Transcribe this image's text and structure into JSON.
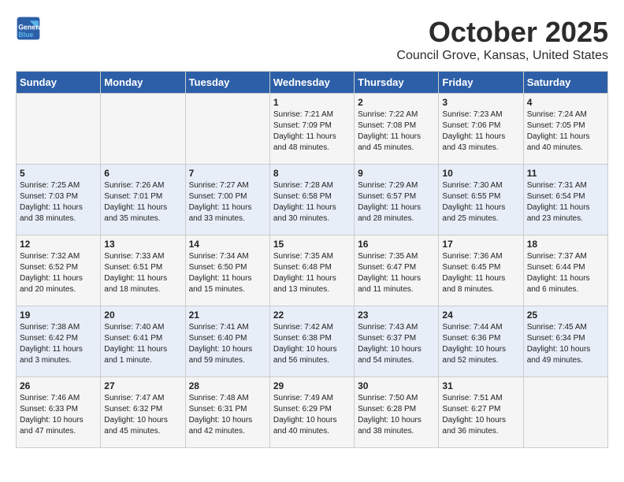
{
  "header": {
    "logo_line1": "General",
    "logo_line2": "Blue",
    "title": "October 2025",
    "subtitle": "Council Grove, Kansas, United States"
  },
  "calendar": {
    "days_of_week": [
      "Sunday",
      "Monday",
      "Tuesday",
      "Wednesday",
      "Thursday",
      "Friday",
      "Saturday"
    ],
    "weeks": [
      [
        {
          "day": "",
          "info": ""
        },
        {
          "day": "",
          "info": ""
        },
        {
          "day": "",
          "info": ""
        },
        {
          "day": "1",
          "info": "Sunrise: 7:21 AM\nSunset: 7:09 PM\nDaylight: 11 hours\nand 48 minutes."
        },
        {
          "day": "2",
          "info": "Sunrise: 7:22 AM\nSunset: 7:08 PM\nDaylight: 11 hours\nand 45 minutes."
        },
        {
          "day": "3",
          "info": "Sunrise: 7:23 AM\nSunset: 7:06 PM\nDaylight: 11 hours\nand 43 minutes."
        },
        {
          "day": "4",
          "info": "Sunrise: 7:24 AM\nSunset: 7:05 PM\nDaylight: 11 hours\nand 40 minutes."
        }
      ],
      [
        {
          "day": "5",
          "info": "Sunrise: 7:25 AM\nSunset: 7:03 PM\nDaylight: 11 hours\nand 38 minutes."
        },
        {
          "day": "6",
          "info": "Sunrise: 7:26 AM\nSunset: 7:01 PM\nDaylight: 11 hours\nand 35 minutes."
        },
        {
          "day": "7",
          "info": "Sunrise: 7:27 AM\nSunset: 7:00 PM\nDaylight: 11 hours\nand 33 minutes."
        },
        {
          "day": "8",
          "info": "Sunrise: 7:28 AM\nSunset: 6:58 PM\nDaylight: 11 hours\nand 30 minutes."
        },
        {
          "day": "9",
          "info": "Sunrise: 7:29 AM\nSunset: 6:57 PM\nDaylight: 11 hours\nand 28 minutes."
        },
        {
          "day": "10",
          "info": "Sunrise: 7:30 AM\nSunset: 6:55 PM\nDaylight: 11 hours\nand 25 minutes."
        },
        {
          "day": "11",
          "info": "Sunrise: 7:31 AM\nSunset: 6:54 PM\nDaylight: 11 hours\nand 23 minutes."
        }
      ],
      [
        {
          "day": "12",
          "info": "Sunrise: 7:32 AM\nSunset: 6:52 PM\nDaylight: 11 hours\nand 20 minutes."
        },
        {
          "day": "13",
          "info": "Sunrise: 7:33 AM\nSunset: 6:51 PM\nDaylight: 11 hours\nand 18 minutes."
        },
        {
          "day": "14",
          "info": "Sunrise: 7:34 AM\nSunset: 6:50 PM\nDaylight: 11 hours\nand 15 minutes."
        },
        {
          "day": "15",
          "info": "Sunrise: 7:35 AM\nSunset: 6:48 PM\nDaylight: 11 hours\nand 13 minutes."
        },
        {
          "day": "16",
          "info": "Sunrise: 7:35 AM\nSunset: 6:47 PM\nDaylight: 11 hours\nand 11 minutes."
        },
        {
          "day": "17",
          "info": "Sunrise: 7:36 AM\nSunset: 6:45 PM\nDaylight: 11 hours\nand 8 minutes."
        },
        {
          "day": "18",
          "info": "Sunrise: 7:37 AM\nSunset: 6:44 PM\nDaylight: 11 hours\nand 6 minutes."
        }
      ],
      [
        {
          "day": "19",
          "info": "Sunrise: 7:38 AM\nSunset: 6:42 PM\nDaylight: 11 hours\nand 3 minutes."
        },
        {
          "day": "20",
          "info": "Sunrise: 7:40 AM\nSunset: 6:41 PM\nDaylight: 11 hours\nand 1 minute."
        },
        {
          "day": "21",
          "info": "Sunrise: 7:41 AM\nSunset: 6:40 PM\nDaylight: 10 hours\nand 59 minutes."
        },
        {
          "day": "22",
          "info": "Sunrise: 7:42 AM\nSunset: 6:38 PM\nDaylight: 10 hours\nand 56 minutes."
        },
        {
          "day": "23",
          "info": "Sunrise: 7:43 AM\nSunset: 6:37 PM\nDaylight: 10 hours\nand 54 minutes."
        },
        {
          "day": "24",
          "info": "Sunrise: 7:44 AM\nSunset: 6:36 PM\nDaylight: 10 hours\nand 52 minutes."
        },
        {
          "day": "25",
          "info": "Sunrise: 7:45 AM\nSunset: 6:34 PM\nDaylight: 10 hours\nand 49 minutes."
        }
      ],
      [
        {
          "day": "26",
          "info": "Sunrise: 7:46 AM\nSunset: 6:33 PM\nDaylight: 10 hours\nand 47 minutes."
        },
        {
          "day": "27",
          "info": "Sunrise: 7:47 AM\nSunset: 6:32 PM\nDaylight: 10 hours\nand 45 minutes."
        },
        {
          "day": "28",
          "info": "Sunrise: 7:48 AM\nSunset: 6:31 PM\nDaylight: 10 hours\nand 42 minutes."
        },
        {
          "day": "29",
          "info": "Sunrise: 7:49 AM\nSunset: 6:29 PM\nDaylight: 10 hours\nand 40 minutes."
        },
        {
          "day": "30",
          "info": "Sunrise: 7:50 AM\nSunset: 6:28 PM\nDaylight: 10 hours\nand 38 minutes."
        },
        {
          "day": "31",
          "info": "Sunrise: 7:51 AM\nSunset: 6:27 PM\nDaylight: 10 hours\nand 36 minutes."
        },
        {
          "day": "",
          "info": ""
        }
      ]
    ]
  }
}
